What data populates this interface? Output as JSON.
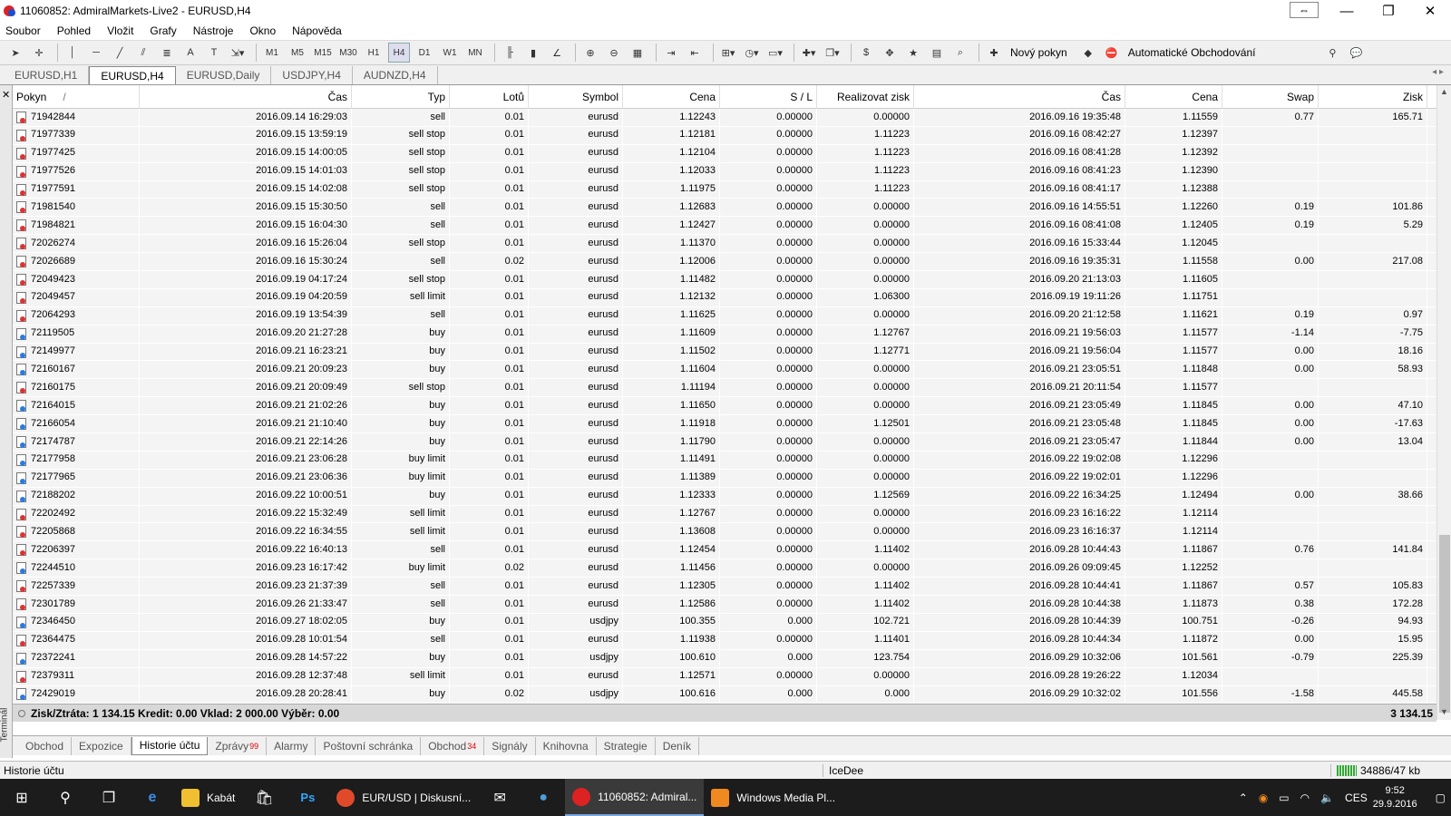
{
  "window": {
    "title": "11060852: AdmiralMarkets-Live2 - EURUSD,H4"
  },
  "menu": [
    "Soubor",
    "Pohled",
    "Vložit",
    "Grafy",
    "Nástroje",
    "Okno",
    "Nápověda"
  ],
  "toolbar": {
    "timeframes": [
      "M1",
      "M5",
      "M15",
      "M30",
      "H1",
      "H4",
      "D1",
      "W1",
      "MN"
    ],
    "active_timeframe": "H4",
    "new_order_label": "Nový pokyn",
    "auto_trading_label": "Automatické Obchodování"
  },
  "chart_tabs": [
    "EURUSD,H1",
    "EURUSD,H4",
    "EURUSD,Daily",
    "USDJPY,H4",
    "AUDNZD,H4"
  ],
  "active_chart_tab": "EURUSD,H4",
  "columns": {
    "pokyn": "Pokyn",
    "sort_mark": "/",
    "cas": "Čas",
    "typ": "Typ",
    "lot": "Lotů",
    "symbol": "Symbol",
    "cena": "Cena",
    "sl": "S / L",
    "tp": "Realizovat zisk",
    "cas2": "Čas",
    "cena2": "Cena",
    "swap": "Swap",
    "zisk": "Zisk"
  },
  "rows": [
    [
      "71942844",
      "2016.09.14 16:29:03",
      "sell",
      "0.01",
      "eurusd",
      "1.12243",
      "0.00000",
      "0.00000",
      "2016.09.16 19:35:48",
      "1.11559",
      "0.77",
      "165.71"
    ],
    [
      "71977339",
      "2016.09.15 13:59:19",
      "sell stop",
      "0.01",
      "eurusd",
      "1.12181",
      "0.00000",
      "1.11223",
      "2016.09.16 08:42:27",
      "1.12397",
      "",
      ""
    ],
    [
      "71977425",
      "2016.09.15 14:00:05",
      "sell stop",
      "0.01",
      "eurusd",
      "1.12104",
      "0.00000",
      "1.11223",
      "2016.09.16 08:41:28",
      "1.12392",
      "",
      ""
    ],
    [
      "71977526",
      "2016.09.15 14:01:03",
      "sell stop",
      "0.01",
      "eurusd",
      "1.12033",
      "0.00000",
      "1.11223",
      "2016.09.16 08:41:23",
      "1.12390",
      "",
      ""
    ],
    [
      "71977591",
      "2016.09.15 14:02:08",
      "sell stop",
      "0.01",
      "eurusd",
      "1.11975",
      "0.00000",
      "1.11223",
      "2016.09.16 08:41:17",
      "1.12388",
      "",
      ""
    ],
    [
      "71981540",
      "2016.09.15 15:30:50",
      "sell",
      "0.01",
      "eurusd",
      "1.12683",
      "0.00000",
      "0.00000",
      "2016.09.16 14:55:51",
      "1.12260",
      "0.19",
      "101.86"
    ],
    [
      "71984821",
      "2016.09.15 16:04:30",
      "sell",
      "0.01",
      "eurusd",
      "1.12427",
      "0.00000",
      "0.00000",
      "2016.09.16 08:41:08",
      "1.12405",
      "0.19",
      "5.29"
    ],
    [
      "72026274",
      "2016.09.16 15:26:04",
      "sell stop",
      "0.01",
      "eurusd",
      "1.11370",
      "0.00000",
      "0.00000",
      "2016.09.16 15:33:44",
      "1.12045",
      "",
      ""
    ],
    [
      "72026689",
      "2016.09.16 15:30:24",
      "sell",
      "0.02",
      "eurusd",
      "1.12006",
      "0.00000",
      "0.00000",
      "2016.09.16 19:35:31",
      "1.11558",
      "0.00",
      "217.08"
    ],
    [
      "72049423",
      "2016.09.19 04:17:24",
      "sell stop",
      "0.01",
      "eurusd",
      "1.11482",
      "0.00000",
      "0.00000",
      "2016.09.20 21:13:03",
      "1.11605",
      "",
      ""
    ],
    [
      "72049457",
      "2016.09.19 04:20:59",
      "sell limit",
      "0.01",
      "eurusd",
      "1.12132",
      "0.00000",
      "1.06300",
      "2016.09.19 19:11:26",
      "1.11751",
      "",
      ""
    ],
    [
      "72064293",
      "2016.09.19 13:54:39",
      "sell",
      "0.01",
      "eurusd",
      "1.11625",
      "0.00000",
      "0.00000",
      "2016.09.20 21:12:58",
      "1.11621",
      "0.19",
      "0.97"
    ],
    [
      "72119505",
      "2016.09.20 21:27:28",
      "buy",
      "0.01",
      "eurusd",
      "1.11609",
      "0.00000",
      "1.12767",
      "2016.09.21 19:56:03",
      "1.11577",
      "-1.14",
      "-7.75"
    ],
    [
      "72149977",
      "2016.09.21 16:23:21",
      "buy",
      "0.01",
      "eurusd",
      "1.11502",
      "0.00000",
      "1.12771",
      "2016.09.21 19:56:04",
      "1.11577",
      "0.00",
      "18.16"
    ],
    [
      "72160167",
      "2016.09.21 20:09:23",
      "buy",
      "0.01",
      "eurusd",
      "1.11604",
      "0.00000",
      "0.00000",
      "2016.09.21 23:05:51",
      "1.11848",
      "0.00",
      "58.93"
    ],
    [
      "72160175",
      "2016.09.21 20:09:49",
      "sell stop",
      "0.01",
      "eurusd",
      "1.11194",
      "0.00000",
      "0.00000",
      "2016.09.21 20:11:54",
      "1.11577",
      "",
      ""
    ],
    [
      "72164015",
      "2016.09.21 21:02:26",
      "buy",
      "0.01",
      "eurusd",
      "1.11650",
      "0.00000",
      "0.00000",
      "2016.09.21 23:05:49",
      "1.11845",
      "0.00",
      "47.10"
    ],
    [
      "72166054",
      "2016.09.21 21:10:40",
      "buy",
      "0.01",
      "eurusd",
      "1.11918",
      "0.00000",
      "1.12501",
      "2016.09.21 23:05:48",
      "1.11845",
      "0.00",
      "-17.63"
    ],
    [
      "72174787",
      "2016.09.21 22:14:26",
      "buy",
      "0.01",
      "eurusd",
      "1.11790",
      "0.00000",
      "0.00000",
      "2016.09.21 23:05:47",
      "1.11844",
      "0.00",
      "13.04"
    ],
    [
      "72177958",
      "2016.09.21 23:06:28",
      "buy limit",
      "0.01",
      "eurusd",
      "1.11491",
      "0.00000",
      "0.00000",
      "2016.09.22 19:02:08",
      "1.12296",
      "",
      ""
    ],
    [
      "72177965",
      "2016.09.21 23:06:36",
      "buy limit",
      "0.01",
      "eurusd",
      "1.11389",
      "0.00000",
      "0.00000",
      "2016.09.22 19:02:01",
      "1.12296",
      "",
      ""
    ],
    [
      "72188202",
      "2016.09.22 10:00:51",
      "buy",
      "0.01",
      "eurusd",
      "1.12333",
      "0.00000",
      "1.12569",
      "2016.09.22 16:34:25",
      "1.12494",
      "0.00",
      "38.66"
    ],
    [
      "72202492",
      "2016.09.22 15:32:49",
      "sell limit",
      "0.01",
      "eurusd",
      "1.12767",
      "0.00000",
      "0.00000",
      "2016.09.23 16:16:22",
      "1.12114",
      "",
      ""
    ],
    [
      "72205868",
      "2016.09.22 16:34:55",
      "sell limit",
      "0.01",
      "eurusd",
      "1.13608",
      "0.00000",
      "0.00000",
      "2016.09.23 16:16:37",
      "1.12114",
      "",
      ""
    ],
    [
      "72206397",
      "2016.09.22 16:40:13",
      "sell",
      "0.01",
      "eurusd",
      "1.12454",
      "0.00000",
      "1.11402",
      "2016.09.28 10:44:43",
      "1.11867",
      "0.76",
      "141.84"
    ],
    [
      "72244510",
      "2016.09.23 16:17:42",
      "buy limit",
      "0.02",
      "eurusd",
      "1.11456",
      "0.00000",
      "0.00000",
      "2016.09.26 09:09:45",
      "1.12252",
      "",
      ""
    ],
    [
      "72257339",
      "2016.09.23 21:37:39",
      "sell",
      "0.01",
      "eurusd",
      "1.12305",
      "0.00000",
      "1.11402",
      "2016.09.28 10:44:41",
      "1.11867",
      "0.57",
      "105.83"
    ],
    [
      "72301789",
      "2016.09.26 21:33:47",
      "sell",
      "0.01",
      "eurusd",
      "1.12586",
      "0.00000",
      "1.11402",
      "2016.09.28 10:44:38",
      "1.11873",
      "0.38",
      "172.28"
    ],
    [
      "72346450",
      "2016.09.27 18:02:05",
      "buy",
      "0.01",
      "usdjpy",
      "100.355",
      "0.000",
      "102.721",
      "2016.09.28 10:44:39",
      "100.751",
      "-0.26",
      "94.93"
    ],
    [
      "72364475",
      "2016.09.28 10:01:54",
      "sell",
      "0.01",
      "eurusd",
      "1.11938",
      "0.00000",
      "1.11401",
      "2016.09.28 10:44:34",
      "1.11872",
      "0.00",
      "15.95"
    ],
    [
      "72372241",
      "2016.09.28 14:57:22",
      "buy",
      "0.01",
      "usdjpy",
      "100.610",
      "0.000",
      "123.754",
      "2016.09.29 10:32:06",
      "101.561",
      "-0.79",
      "225.39"
    ],
    [
      "72379311",
      "2016.09.28 12:37:48",
      "sell limit",
      "0.01",
      "eurusd",
      "1.12571",
      "0.00000",
      "0.00000",
      "2016.09.28 19:26:22",
      "1.12034",
      "",
      ""
    ],
    [
      "72429019",
      "2016.09.28 20:28:41",
      "buy",
      "0.02",
      "usdjpy",
      "100.616",
      "0.000",
      "0.000",
      "2016.09.29 10:32:02",
      "101.556",
      "-1.58",
      "445.58"
    ]
  ],
  "summary": {
    "text": "Zisk/Ztráta: 1 134.15  Kredit: 0.00  Vklad: 2 000.00  Výběr: 0.00",
    "total": "3 134.15"
  },
  "terminal_label": "Terminál",
  "terminal_tabs": [
    {
      "label": "Obchod",
      "badge": ""
    },
    {
      "label": "Expozice",
      "badge": ""
    },
    {
      "label": "Historie účtu",
      "badge": ""
    },
    {
      "label": "Zprávy",
      "badge": "99"
    },
    {
      "label": "Alarmy",
      "badge": ""
    },
    {
      "label": "Poštovní schránka",
      "badge": ""
    },
    {
      "label": "Obchod",
      "badge": "34"
    },
    {
      "label": "Signály",
      "badge": ""
    },
    {
      "label": "Knihovna",
      "badge": ""
    },
    {
      "label": "Strategie",
      "badge": ""
    },
    {
      "label": "Deník",
      "badge": ""
    }
  ],
  "active_terminal_tab": "Historie účtu",
  "status": {
    "left": "Historie účtu",
    "profile": "IceDee",
    "traffic": "34886/47 kb"
  },
  "taskbar": {
    "apps": [
      {
        "label": "Kabát",
        "color": "#f0c030"
      },
      {
        "label": "",
        "color": "#e8e8e8"
      },
      {
        "label": "",
        "color": "#2b5fa8"
      },
      {
        "label": "EUR/USD | Diskusní...",
        "color": "#e04a2a"
      },
      {
        "label": "",
        "color": "#5a7fb0"
      },
      {
        "label": "",
        "color": "#4a9fd8"
      },
      {
        "label": "11060852: Admiral...",
        "color": "#d22"
      },
      {
        "label": "Windows Media Pl...",
        "color": "#f08a20"
      }
    ],
    "lang": "CES",
    "time": "9:52",
    "date": "29.9.2016"
  }
}
